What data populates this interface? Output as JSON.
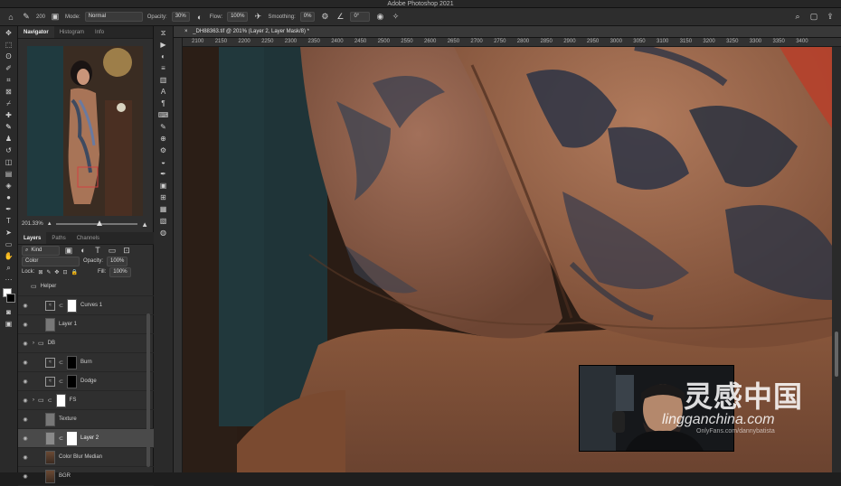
{
  "app": {
    "title": "Adobe Photoshop 2021"
  },
  "options": {
    "brush_size": "200",
    "mode_label": "Mode:",
    "mode_value": "Normal",
    "opacity_label": "Opacity:",
    "opacity_value": "30%",
    "flow_label": "Flow:",
    "flow_value": "100%",
    "smoothing_label": "Smoothing:",
    "smoothing_value": "0%",
    "angle_value": "0°"
  },
  "document": {
    "tab_title": "_DH88363.tif @ 201% (Layer 2, Layer Mask/8) *",
    "ruler_ticks": [
      "2100",
      "2150",
      "2200",
      "2250",
      "2300",
      "2350",
      "2400",
      "2450",
      "2500",
      "2550",
      "2600",
      "2650",
      "2700",
      "2750",
      "2800",
      "2850",
      "2900",
      "2950",
      "3000",
      "3050",
      "3100",
      "3150",
      "3200",
      "3250",
      "3300",
      "3350",
      "3400"
    ]
  },
  "navigator": {
    "tabs": [
      "Navigator",
      "Histogram",
      "Info"
    ],
    "zoom": "201.33%"
  },
  "layers_panel": {
    "tabs": [
      "Layers",
      "Paths",
      "Channels"
    ],
    "filter_kind": "Kind",
    "blend_mode": "Color",
    "opacity_label": "Opacity:",
    "opacity_value": "100%",
    "lock_label": "Lock:",
    "fill_label": "Fill:",
    "fill_value": "100%",
    "layers": [
      {
        "name": "Helper",
        "kind": "group"
      },
      {
        "name": "Curves 1",
        "kind": "adjustment"
      },
      {
        "name": "Layer 1",
        "kind": "pixel"
      },
      {
        "name": "DB",
        "kind": "group"
      },
      {
        "name": "Burn",
        "kind": "adjustment"
      },
      {
        "name": "Dodge",
        "kind": "adjustment"
      },
      {
        "name": "FS",
        "kind": "group"
      },
      {
        "name": "Texture",
        "kind": "pixel"
      },
      {
        "name": "Layer 2",
        "kind": "pixel",
        "selected": true
      },
      {
        "name": "Color Blur Median",
        "kind": "photo"
      },
      {
        "name": "BGR",
        "kind": "photo"
      }
    ]
  },
  "watermark": {
    "cn": "灵感中国",
    "url": "lingganchina.com",
    "onlyfans": "OnlyFans.com/dannybatista"
  },
  "colors": {
    "accent": "#1473e6",
    "skin": "#a36d4d",
    "tattoo": "#2d3445"
  }
}
